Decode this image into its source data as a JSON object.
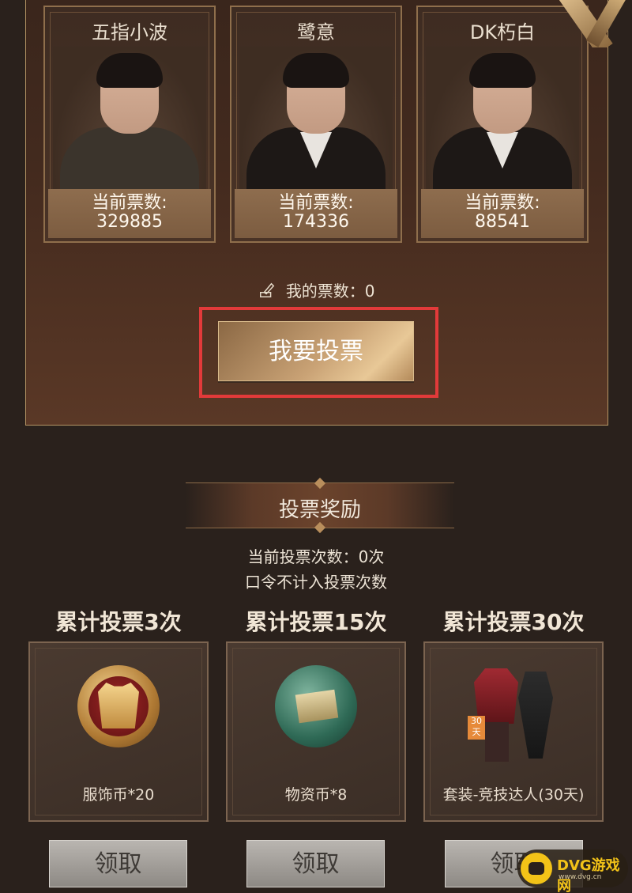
{
  "candidates": [
    {
      "name": "五指小波",
      "votes_label": "当前票数:",
      "votes": "329885"
    },
    {
      "name": "鹭意",
      "votes_label": "当前票数:",
      "votes": "174336"
    },
    {
      "name": "DK朽白",
      "votes_label": "当前票数:",
      "votes": "88541"
    }
  ],
  "my_votes": {
    "label": "我的票数：0",
    "icon": "pen-icon"
  },
  "vote_button": {
    "label": "我要投票"
  },
  "rewards": {
    "title": "投票奖励",
    "current_count": "当前投票次数：0次",
    "note": "口令不计入投票次数",
    "tiers": [
      {
        "title": "累计投票3次",
        "item": "服饰币*20",
        "claim_label": "领取"
      },
      {
        "title": "累计投票15次",
        "item": "物资币*8",
        "claim_label": "领取"
      },
      {
        "title": "累计投票30次",
        "item": "套装-竞技达人(30天)",
        "claim_label": "领取",
        "tag": "30天"
      }
    ]
  },
  "watermark": {
    "brand": "DVG游戏网",
    "url": "www.dvg.cn"
  },
  "colors": {
    "highlight": "#e23a3a",
    "accent_gold": "#c9a275",
    "background": "#2a211c"
  }
}
